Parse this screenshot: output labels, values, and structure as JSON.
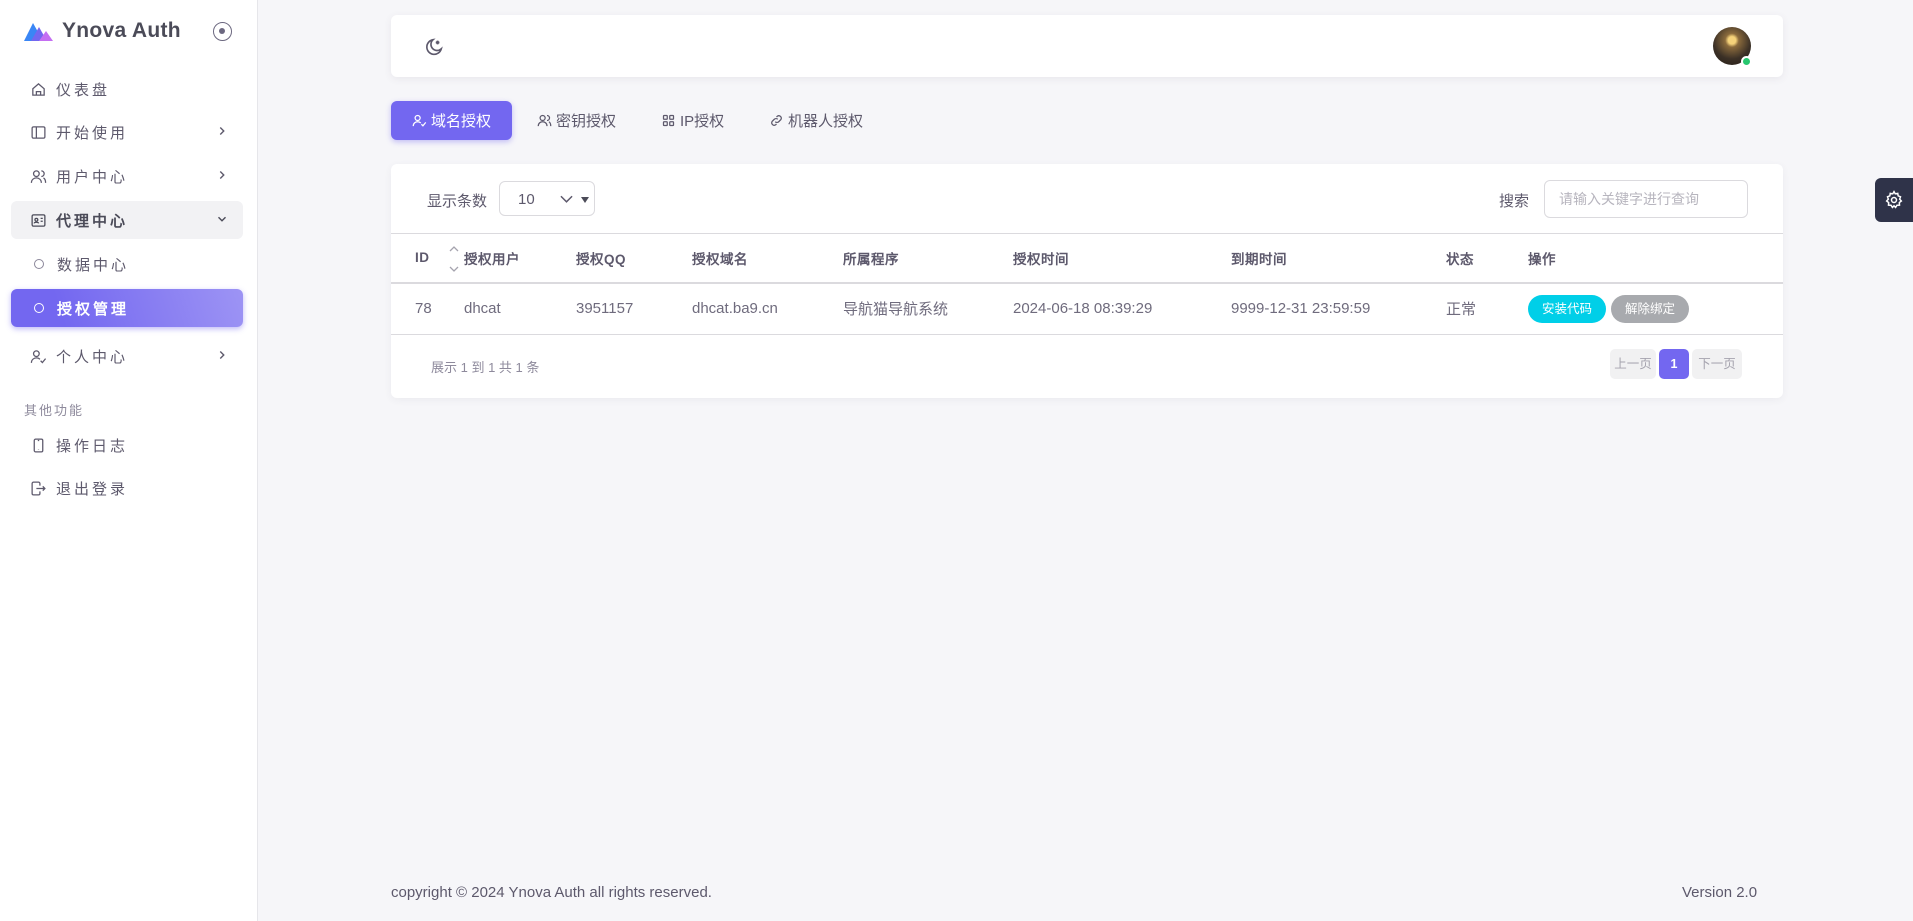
{
  "app": {
    "title": "Ynova Auth"
  },
  "colors": {
    "primary": "#7367f0",
    "info": "#00cfe8",
    "secondary": "#a8aaae",
    "online": "#28c76f"
  },
  "sidebar": {
    "items": [
      {
        "label": "仪表盘",
        "icon": "home-icon"
      },
      {
        "label": "开始使用",
        "icon": "layout-icon"
      },
      {
        "label": "用户中心",
        "icon": "users-icon"
      },
      {
        "label": "代理中心",
        "icon": "id-card-icon"
      },
      {
        "label": "数据中心",
        "icon": "circle-dot-icon"
      },
      {
        "label": "授权管理",
        "icon": "circle-dot-icon"
      },
      {
        "label": "个人中心",
        "icon": "user-check-icon"
      }
    ],
    "section_header": "其他功能",
    "extra_items": [
      {
        "label": "操作日志",
        "icon": "device-mobile-icon"
      },
      {
        "label": "退出登录",
        "icon": "logout-icon"
      }
    ]
  },
  "tabs": [
    {
      "label": "域名授权",
      "icon": "user-check-icon",
      "active": true
    },
    {
      "label": "密钥授权",
      "icon": "users-icon",
      "active": false
    },
    {
      "label": "IP授权",
      "icon": "grid-icon",
      "active": false
    },
    {
      "label": "机器人授权",
      "icon": "link-icon",
      "active": false
    }
  ],
  "table_controls": {
    "show_label": "显示条数",
    "page_size": "10",
    "search_label": "搜索",
    "search_placeholder": "请输入关键字进行查询"
  },
  "table": {
    "columns": [
      "ID",
      "授权用户",
      "授权QQ",
      "授权域名",
      "所属程序",
      "授权时间",
      "到期时间",
      "状态",
      "操作"
    ],
    "rows": [
      {
        "id": "78",
        "user": "dhcat",
        "qq": "3951157",
        "domain": "dhcat.ba9.cn",
        "program": "导航猫导航系统",
        "auth_time": "2024-06-18 08:39:29",
        "expire_time": "9999-12-31 23:59:59",
        "status": "正常",
        "actions": [
          "安装代码",
          "解除绑定"
        ]
      }
    ]
  },
  "pagination": {
    "info": "展示 1 到 1 共 1 条",
    "prev": "上一页",
    "current": "1",
    "next": "下一页"
  },
  "footer": {
    "copyright": "copyright © 2024 Ynova Auth all rights reserved.",
    "version": "Version 2.0"
  }
}
